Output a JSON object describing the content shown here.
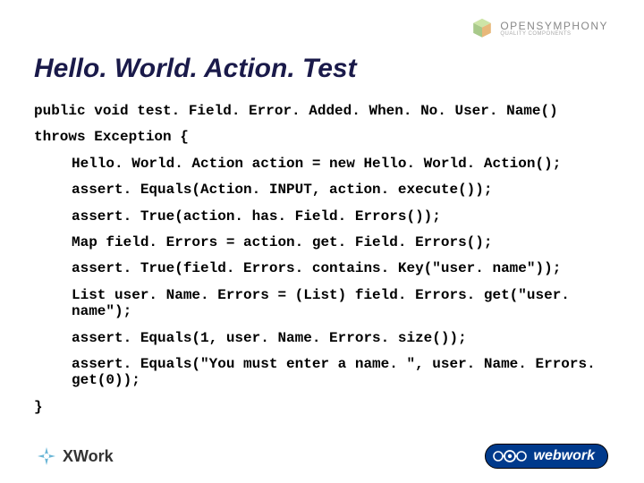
{
  "header": {
    "logo_main": "OPENSYMPHONY",
    "logo_sub": "QUALITY COMPONENTS"
  },
  "title": "Hello. World. Action. Test",
  "code": {
    "l1": "public void test. Field. Error. Added. When. No. User. Name()",
    "l2": "throws Exception {",
    "l3": "Hello. World. Action action = new Hello. World. Action();",
    "l4": "assert. Equals(Action. INPUT, action. execute());",
    "l5": "assert. True(action. has. Field. Errors());",
    "l6": "Map field. Errors = action. get. Field. Errors();",
    "l7": "assert. True(field. Errors. contains. Key(\"user. name\"));",
    "l8": "List user. Name. Errors = (List) field. Errors. get(\"user. name\");",
    "l9": "assert. Equals(1, user. Name. Errors. size());",
    "l10": "assert. Equals(\"You must enter a name. \", user. Name. Errors. get(0));",
    "l11": "}"
  },
  "footer": {
    "xwork": "XWork",
    "webwork": "webwork"
  }
}
